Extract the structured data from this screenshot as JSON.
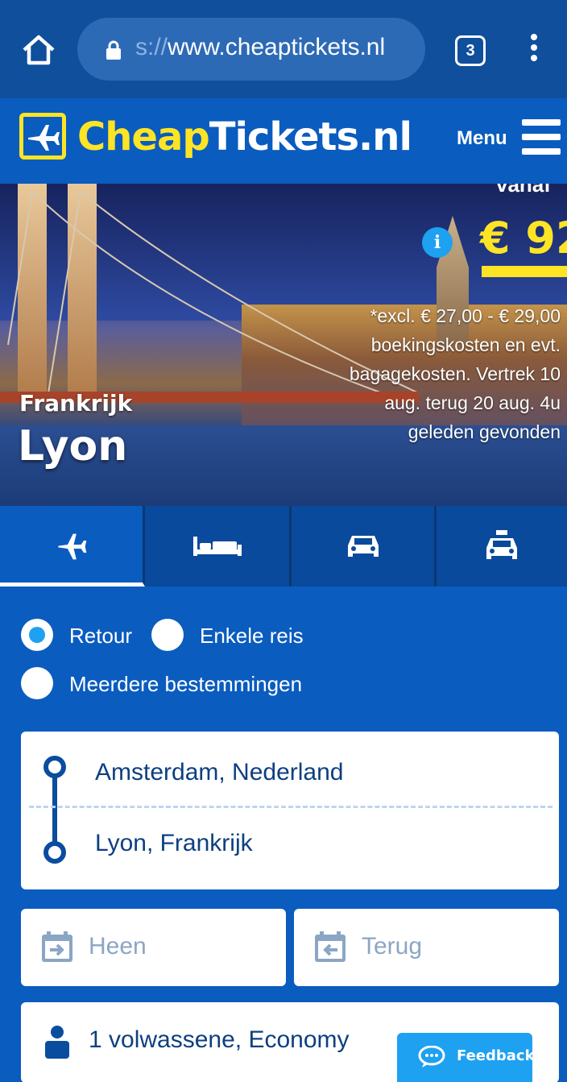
{
  "browser": {
    "url_prefix": "s://",
    "url_domain": "www.cheaptickets.nl",
    "tab_count": "3"
  },
  "header": {
    "logo_part1": "Cheap",
    "logo_part2": "Tickets.nl",
    "menu_label": "Menu"
  },
  "hero": {
    "from_label": "vanaf",
    "price": "€ 92",
    "price_mark": "*",
    "note": "*excl. € 27,00 - € 29,00 boekingskosten en evt. bagagekosten. Vertrek 10 aug. terug 20 aug. 4u geleden gevonden",
    "country": "Frankrijk",
    "city": "Lyon"
  },
  "tabs": [
    {
      "icon": "airplane-icon",
      "active": true
    },
    {
      "icon": "bed-icon",
      "active": false
    },
    {
      "icon": "car-icon",
      "active": false
    },
    {
      "icon": "taxi-icon",
      "active": false
    }
  ],
  "trip_type": {
    "options": [
      {
        "label": "Retour",
        "checked": true
      },
      {
        "label": "Enkele reis",
        "checked": false
      },
      {
        "label": "Meerdere bestemmingen",
        "checked": false
      }
    ]
  },
  "route": {
    "from": "Amsterdam, Nederland",
    "to": "Lyon, Frankrijk"
  },
  "dates": {
    "depart_placeholder": "Heen",
    "return_placeholder": "Terug"
  },
  "passengers": {
    "value": "1 volwassene, Economy"
  },
  "feedback": {
    "label": "Feedback"
  },
  "colors": {
    "brand_blue": "#0a5cbf",
    "brand_yellow": "#fde425",
    "accent_cyan": "#1ea1f1"
  }
}
